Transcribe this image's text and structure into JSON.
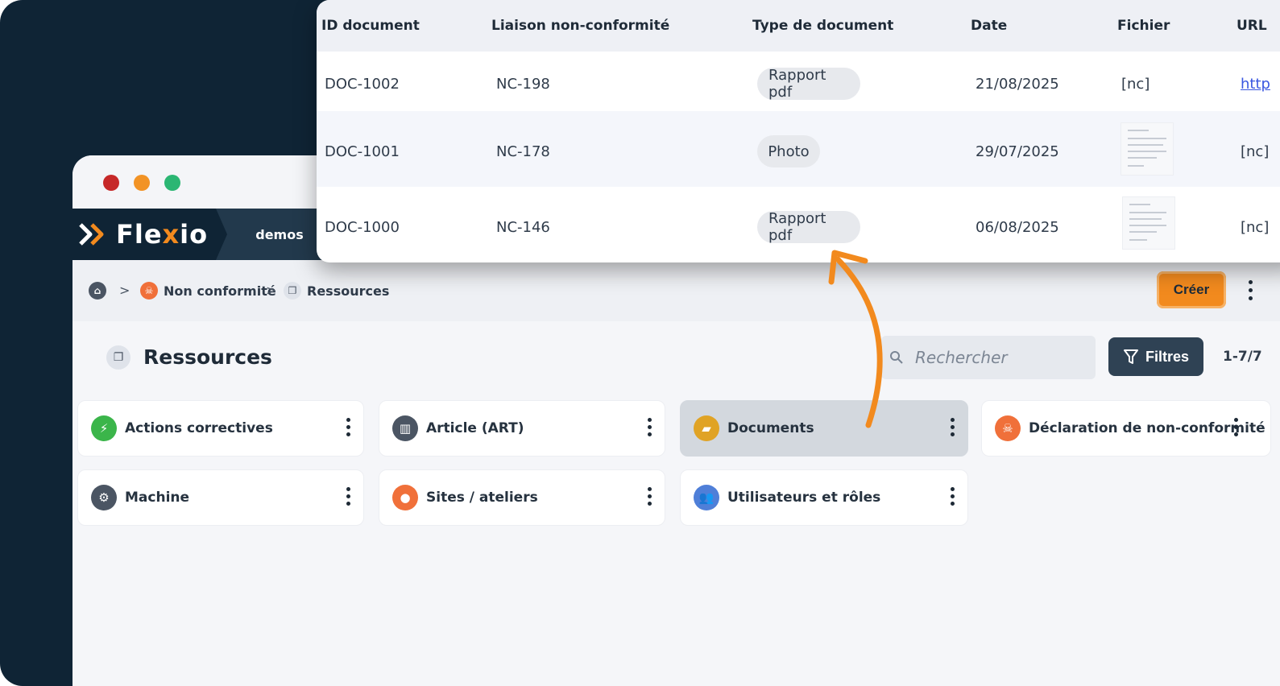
{
  "window": {
    "brand": "Flexio",
    "brand_prefix": "Fle",
    "brand_x": "x",
    "brand_suffix": "io",
    "workspace": "demos"
  },
  "breadcrumb": {
    "items": [
      "Non conformité",
      "Ressources"
    ],
    "separator": ">"
  },
  "toolbar": {
    "create_label": "Créer"
  },
  "page": {
    "title": "Ressources"
  },
  "search": {
    "placeholder": "Rechercher"
  },
  "filters": {
    "label": "Filtres"
  },
  "pager": {
    "range": "1-7/7"
  },
  "resources": [
    {
      "label": "Actions correctives",
      "icon": "lightning-icon",
      "color": "#3bb54a"
    },
    {
      "label": "Article (ART)",
      "icon": "barcode-icon",
      "color": "#4b5563"
    },
    {
      "label": "Documents",
      "icon": "folder-icon",
      "color": "#e0a325",
      "active": true
    },
    {
      "label": "Déclaration de non-conformité",
      "icon": "skull-icon",
      "color": "#f0703a"
    },
    {
      "label": "Machine",
      "icon": "gear-icon",
      "color": "#4b5563"
    },
    {
      "label": "Sites / ateliers",
      "icon": "location-pin-icon",
      "color": "#f0703a"
    },
    {
      "label": "Utilisateurs et rôles",
      "icon": "users-icon",
      "color": "#4f7fd8"
    }
  ],
  "table": {
    "columns": [
      "ID document",
      "Liaison non-conformité",
      "Type de document",
      "Date",
      "Fichier",
      "URL"
    ],
    "rows": [
      {
        "id": "DOC-1002",
        "nc": "NC-198",
        "type": "Rapport pdf",
        "date": "21/08/2025",
        "file": "[nc]",
        "url": "http"
      },
      {
        "id": "DOC-1001",
        "nc": "NC-178",
        "type": "Photo",
        "date": "29/07/2025",
        "file": "thumbnail",
        "url": "[nc]"
      },
      {
        "id": "DOC-1000",
        "nc": "NC-146",
        "type": "Rapport pdf",
        "date": "06/08/2025",
        "file": "thumbnail",
        "url": "[nc]"
      }
    ]
  },
  "colors": {
    "accent": "#f28a1e",
    "dark": "#0f2435",
    "link": "#3a57e0"
  }
}
